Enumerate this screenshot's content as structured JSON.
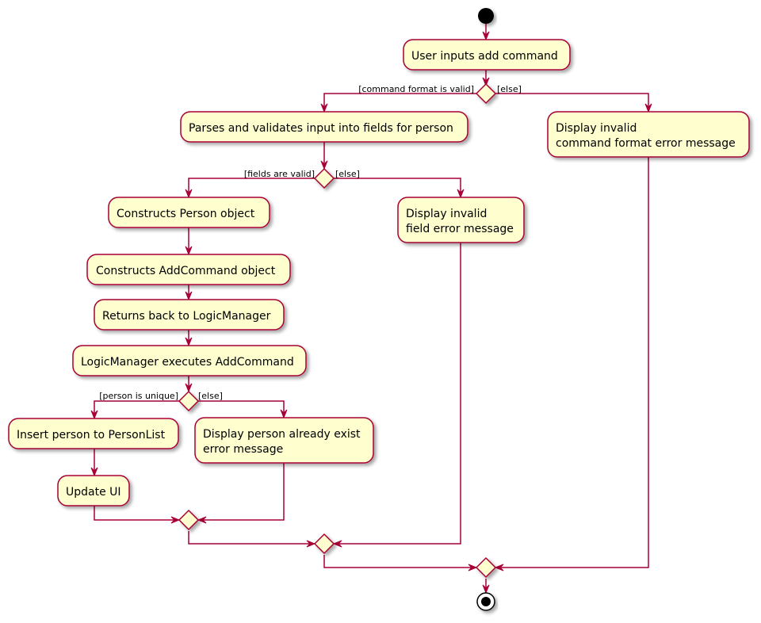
{
  "diagram": {
    "type": "uml-activity",
    "colors": {
      "line": "#A80036",
      "node_fill": "#FEFECE",
      "node_border": "#A80036",
      "text": "#000000",
      "start_end": "#000000"
    },
    "nodes": {
      "user_inputs": {
        "lines": [
          "User inputs add command"
        ]
      },
      "parses": {
        "lines": [
          "Parses and validates input into fields for person"
        ]
      },
      "invalid_command": {
        "lines": [
          "Display invalid",
          "command format error message"
        ]
      },
      "construct_person": {
        "lines": [
          "Constructs Person object"
        ]
      },
      "invalid_field": {
        "lines": [
          "Display invalid",
          "field error message"
        ]
      },
      "construct_addcommand": {
        "lines": [
          "Constructs AddCommand object"
        ]
      },
      "returns_logic": {
        "lines": [
          "Returns back to LogicManager"
        ]
      },
      "logic_executes": {
        "lines": [
          "LogicManager executes AddCommand"
        ]
      },
      "insert_person": {
        "lines": [
          "Insert person to PersonList"
        ]
      },
      "person_exists": {
        "lines": [
          "Display person already exist",
          "error message"
        ]
      },
      "update_ui": {
        "lines": [
          "Update UI"
        ]
      }
    },
    "guards": {
      "command_valid": "[command format is valid]",
      "command_else": "[else]",
      "fields_valid": "[fields are valid]",
      "fields_else": "[else]",
      "person_unique": "[person is unique]",
      "person_else": "[else]"
    }
  }
}
